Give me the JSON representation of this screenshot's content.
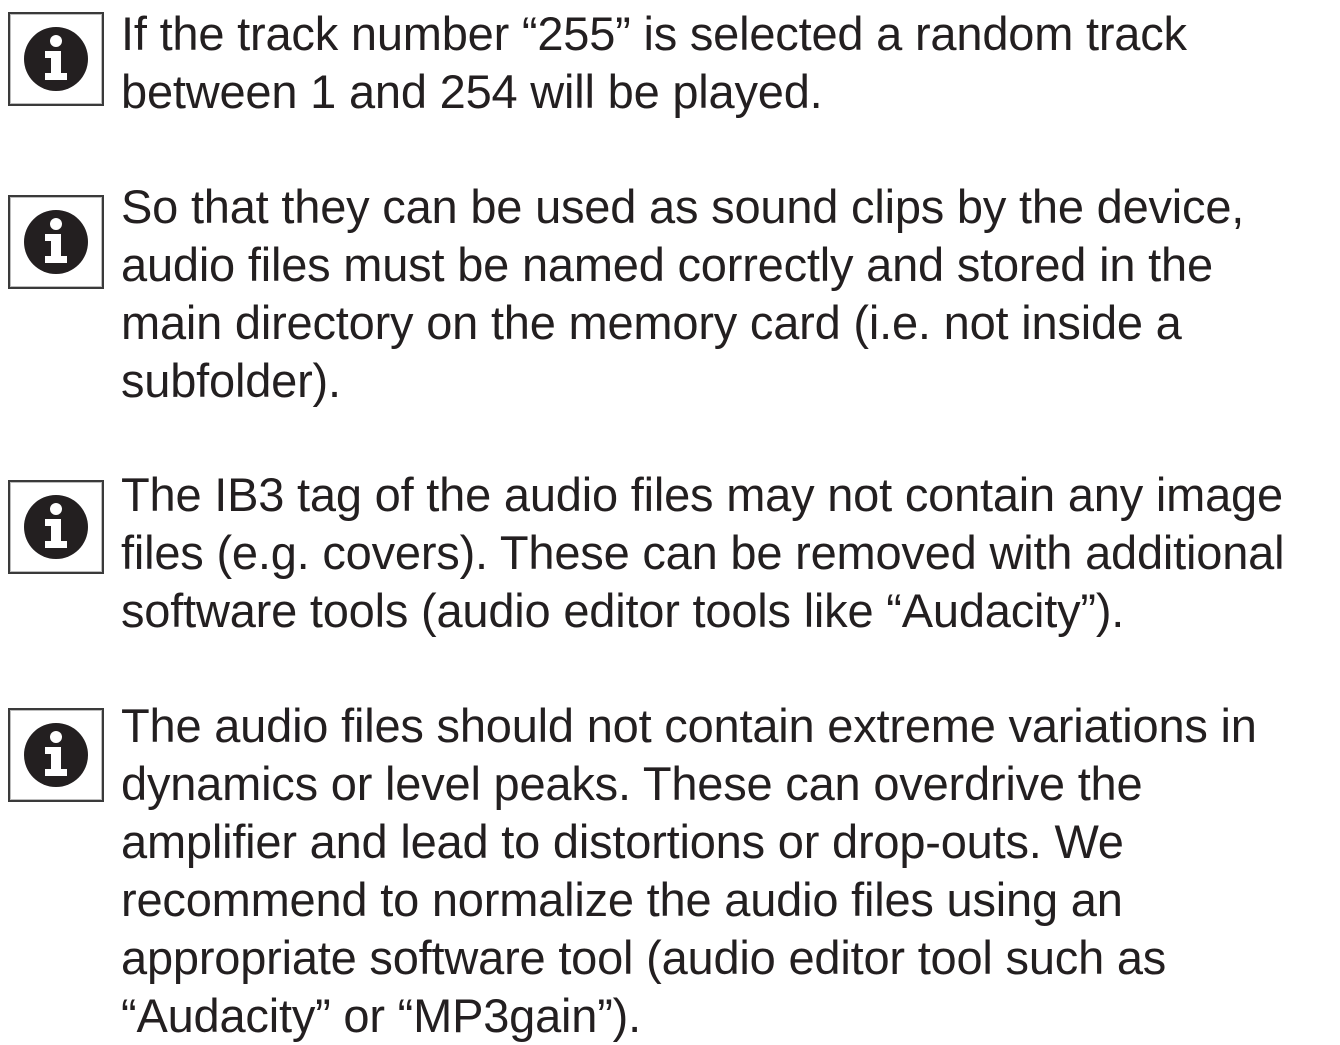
{
  "notes": [
    {
      "icon": "info-icon",
      "text": "If the track number “255” is selected a random track\nbetween 1 and 254 will be played."
    },
    {
      "icon": "info-icon",
      "text": "So that they can be used as sound clips by the device,\naudio files must be named correctly and stored in the\nmain directory on the memory card (i.e. not inside a\nsubfolder)."
    },
    {
      "icon": "info-icon",
      "text": "The IB3 tag of the audio files may not contain any image\nfiles (e.g. covers). These can be removed with additional\nsoftware tools (audio editor tools like “Audacity”)."
    },
    {
      "icon": "info-icon",
      "text": "The audio files should not contain extreme variations in\ndynamics or level peaks. These can overdrive the\namplifier and lead to distortions or drop-outs. We\nrecommend to normalize the audio files using an\nappropriate software tool (audio editor tool such as\n“Audacity” or “MP3gain”)."
    }
  ],
  "colors": {
    "text": "#231f20",
    "icon_fill": "#231f20",
    "icon_border": "#3a3a3a",
    "background": "#ffffff"
  }
}
